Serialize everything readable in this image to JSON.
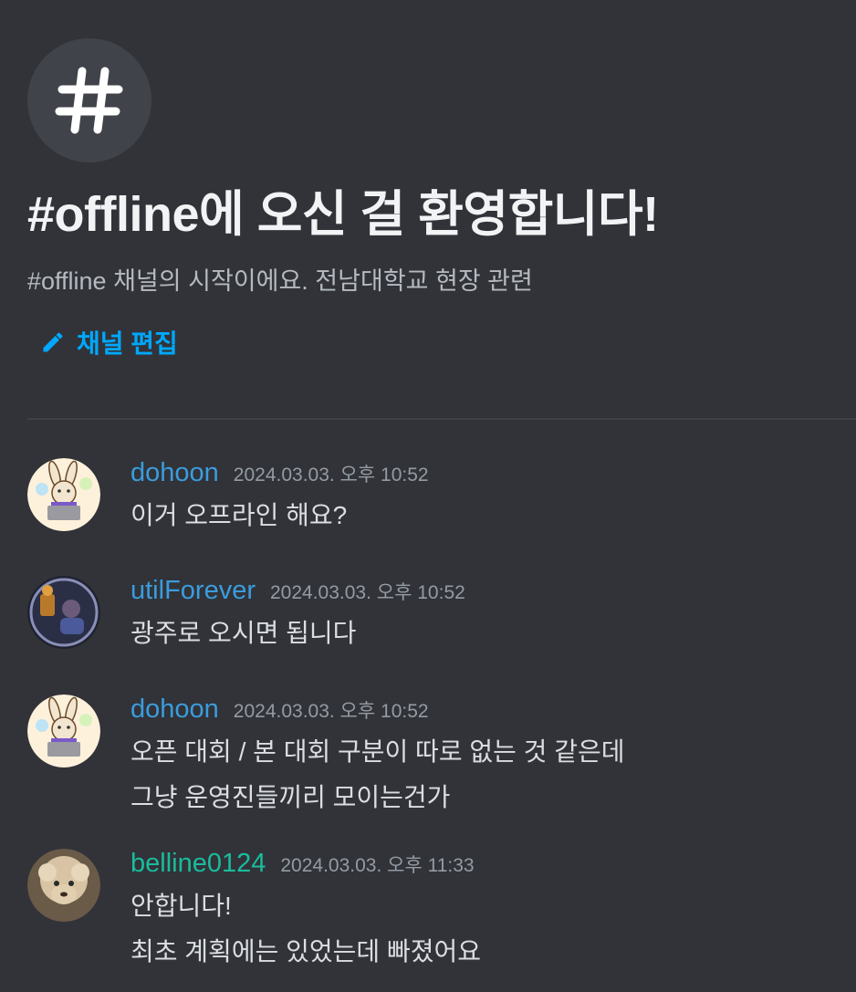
{
  "channel": {
    "hash_symbol": "#",
    "welcome_title": "#offline에 오신 걸 환영합니다!",
    "welcome_subtitle": "#offline 채널의 시작이에요. 전남대학교 현장 관련",
    "edit_label": "채널 편집",
    "accent_color": "#00a8fc"
  },
  "messages": [
    {
      "username": "dohoon",
      "name_color": "#3b9cdd",
      "timestamp": "2024.03.03. 오후 10:52",
      "avatar_icon": "rabbit-laptop-avatar",
      "lines": [
        "이거 오프라인 해요?"
      ]
    },
    {
      "username": "utilForever",
      "name_color": "#3b9cdd",
      "timestamp": "2024.03.03. 오후 10:52",
      "avatar_icon": "person-photo-avatar",
      "lines": [
        "광주로 오시면 됩니다"
      ]
    },
    {
      "username": "dohoon",
      "name_color": "#3b9cdd",
      "timestamp": "2024.03.03. 오후 10:52",
      "avatar_icon": "rabbit-laptop-avatar",
      "lines": [
        "오픈 대회 / 본 대회 구분이 따로 없는 것 같은데",
        "그냥 운영진들끼리 모이는건가"
      ]
    },
    {
      "username": "belline0124",
      "name_color": "#1abc9c",
      "timestamp": "2024.03.03. 오후 11:33",
      "avatar_icon": "alpaca-avatar",
      "lines": [
        "안합니다!",
        "최초 계획에는 있었는데 빠졌어요"
      ]
    }
  ]
}
